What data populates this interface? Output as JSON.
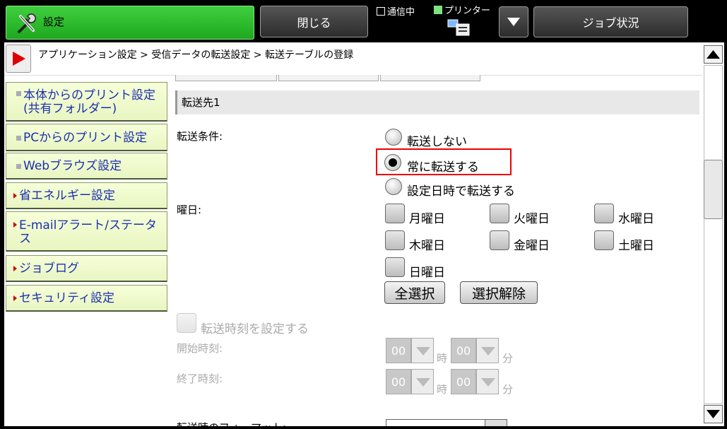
{
  "header": {
    "settings_label": "設定",
    "close_label": "閉じる",
    "status_comm": "通信中",
    "status_printer": "プリンター",
    "job_status_label": "ジョブ状況",
    "accent_green": "#2fbf2f"
  },
  "breadcrumb": "アプリケーション設定 > 受信データの転送設定 > 転送テーブルの登録",
  "sidebar": {
    "items": [
      {
        "label": "本体からのプリント設定 (共有フォルダー)"
      },
      {
        "label": "PCからのプリント設定"
      },
      {
        "label": "Webブラウズ設定"
      },
      {
        "label": "省エネルギー設定"
      },
      {
        "label": "E-mailアラート/ステータス"
      },
      {
        "label": "ジョブログ"
      },
      {
        "label": "セキュリティ設定"
      }
    ]
  },
  "form": {
    "section_title": "転送先1",
    "condition_label": "転送条件:",
    "radios": [
      {
        "label": "転送しない",
        "selected": false
      },
      {
        "label": "常に転送する",
        "selected": true
      },
      {
        "label": "設定日時で転送する",
        "selected": false
      }
    ],
    "day_label": "曜日:",
    "days": [
      "月曜日",
      "火曜日",
      "水曜日",
      "木曜日",
      "金曜日",
      "土曜日",
      "日曜日"
    ],
    "select_all": "全選択",
    "deselect": "選択解除",
    "set_time_label": "転送時刻を設定する",
    "start_label": "開始時刻:",
    "end_label": "終了時刻:",
    "hour_value": "00",
    "minute_value": "00",
    "hour_unit": "時",
    "minute_unit": "分",
    "format_label": "転送時のフォーマット:"
  }
}
